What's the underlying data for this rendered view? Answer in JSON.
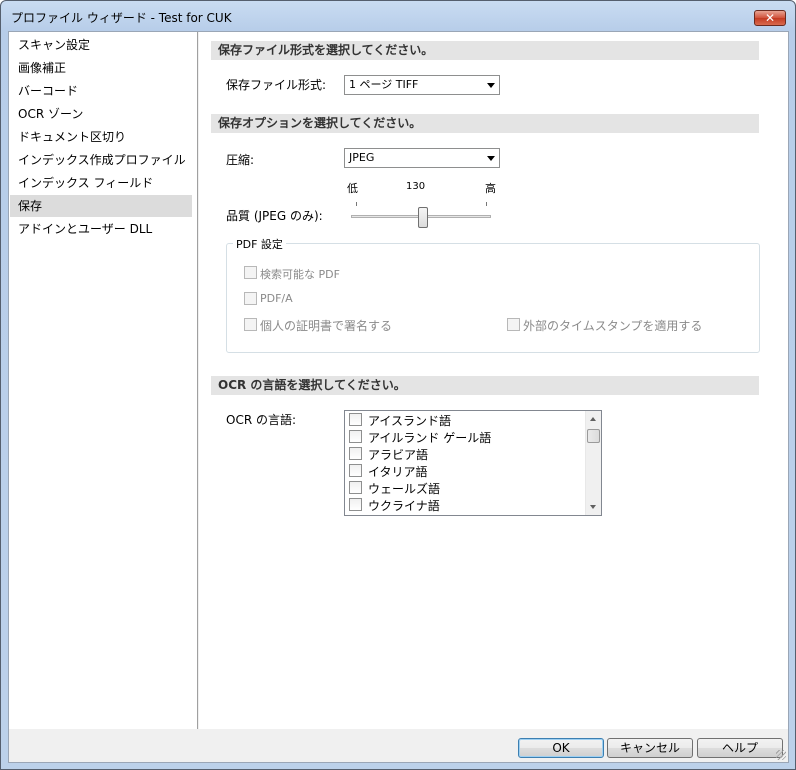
{
  "window": {
    "title": "プロファイル ウィザード - Test for CUK",
    "close_label": "✕"
  },
  "sidebar": {
    "items": [
      {
        "label": "スキャン設定"
      },
      {
        "label": "画像補正"
      },
      {
        "label": "バーコード"
      },
      {
        "label": "OCR ゾーン"
      },
      {
        "label": "ドキュメント区切り"
      },
      {
        "label": "インデックス作成プロファイル"
      },
      {
        "label": "インデックス フィールド"
      },
      {
        "label": "保存",
        "selected": true
      },
      {
        "label": "アドインとユーザー DLL"
      }
    ]
  },
  "format_section": {
    "header": "保存ファイル形式を選択してください。",
    "label": "保存ファイル形式:",
    "selected": "1 ページ TIFF"
  },
  "options_section": {
    "header": "保存オプションを選択してください。",
    "compression_label": "圧縮:",
    "compression_selected": "JPEG",
    "quality_label": "品質 (JPEG のみ):",
    "slider_low": "低",
    "slider_value": "130",
    "slider_high": "高",
    "slider_min": 0,
    "slider_max": 255,
    "pdf": {
      "title": "PDF 設定",
      "searchable_label": "検索可能な PDF",
      "pdfa_label": "PDF/A",
      "sign_label": "個人の証明書で署名する",
      "timestamp_label": "外部のタイムスタンプを適用する"
    }
  },
  "ocr_section": {
    "header": "OCR の言語を選択してください。",
    "label": "OCR の言語:",
    "languages": [
      "アイスランド語",
      "アイルランド ゲール語",
      "アラビア語",
      "イタリア語",
      "ウェールズ語",
      "ウクライナ語"
    ]
  },
  "footer": {
    "ok": "OK",
    "cancel": "キャンセル",
    "help": "ヘルプ"
  }
}
